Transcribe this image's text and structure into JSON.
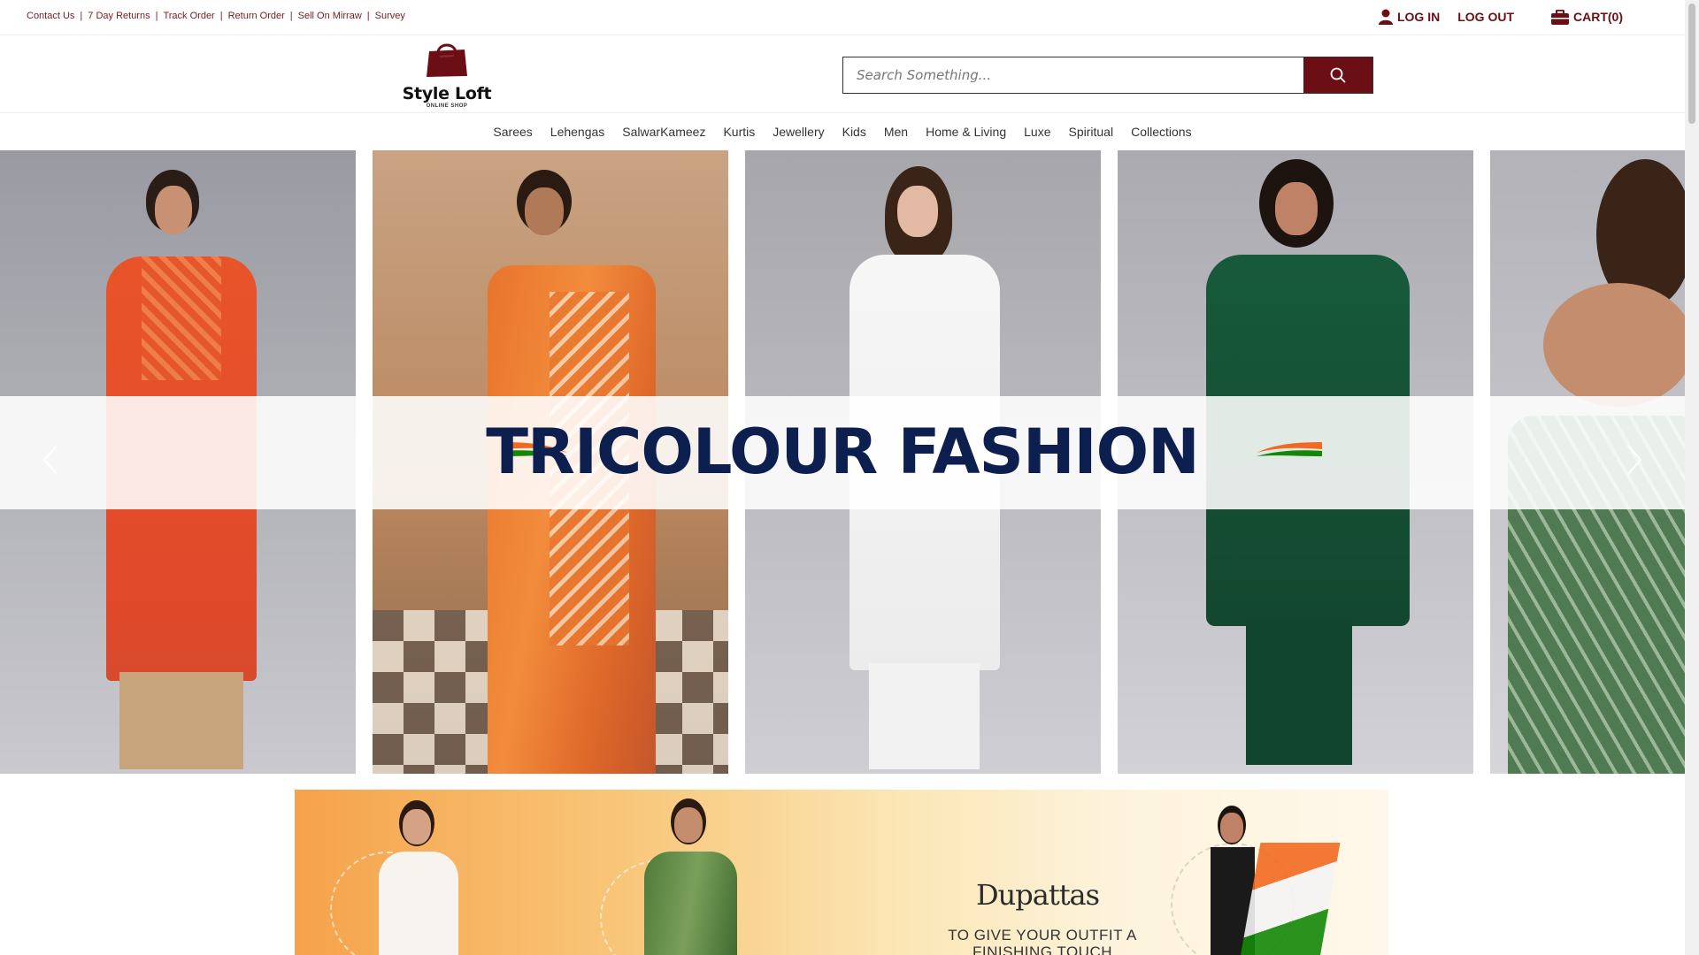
{
  "top_links": [
    "Contact Us",
    "7 Day Returns",
    "Track Order",
    "Return Order",
    "Sell On Mirraw",
    "Survey"
  ],
  "account": {
    "login": "LOG IN",
    "logout": "LOG OUT",
    "cart": "CART(0)"
  },
  "brand": {
    "name": "Style Loft",
    "tagline": "ONLINE SHOP"
  },
  "search": {
    "placeholder": "Search Something..."
  },
  "nav": [
    "Sarees",
    "Lehengas",
    "SalwarKameez",
    "Kurtis",
    "Jewellery",
    "Kids",
    "Men",
    "Home & Living",
    "Luxe",
    "Spiritual",
    "Collections"
  ],
  "hero": {
    "title": "TRICOLOUR FASHION"
  },
  "promo": {
    "title": "Dupattas",
    "subtitle": "TO GIVE YOUR OUTFIT A FINISHING TOUCH"
  },
  "colors": {
    "brand": "#6b0f14",
    "hero_title": "#0c1f4f",
    "saffron": "#f26a21",
    "green": "#138808"
  },
  "icons": [
    "user-icon",
    "briefcase-icon",
    "search-icon",
    "chevron-left-icon",
    "chevron-right-icon",
    "shopping-bag-icon"
  ]
}
